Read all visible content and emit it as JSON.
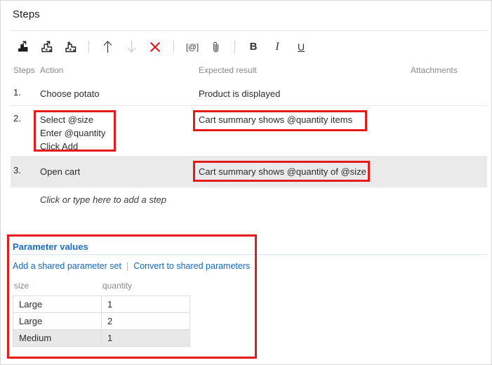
{
  "panel": {
    "title": "Steps"
  },
  "toolbar": {
    "items": [
      {
        "name": "insert-step-icon",
        "glyph": "step",
        "variant": "arrow"
      },
      {
        "name": "insert-step-above-icon",
        "glyph": "step",
        "variant": "arrow2"
      },
      {
        "name": "add-step-icon",
        "glyph": "step",
        "variant": "plus"
      },
      {
        "name": "move-up-icon",
        "glyph": "↑"
      },
      {
        "name": "move-down-icon",
        "glyph": "↓"
      },
      {
        "name": "delete-icon",
        "glyph": "✕"
      },
      {
        "name": "mention-icon",
        "glyph": "[@]"
      },
      {
        "name": "attachment-icon",
        "glyph": "paperclip"
      },
      {
        "name": "bold-icon",
        "glyph": "B"
      },
      {
        "name": "italic-icon",
        "glyph": "I"
      },
      {
        "name": "underline-icon",
        "glyph": "U"
      }
    ]
  },
  "grid": {
    "headers": {
      "steps": "Steps",
      "action": "Action",
      "expected_result": "Expected result",
      "attachments": "Attachments"
    },
    "rows": [
      {
        "number": "1.",
        "action": "Choose potato",
        "expected": "Product is displayed",
        "selected": false
      },
      {
        "number": "2.",
        "action": "Select @size\nEnter @quantity\nClick Add",
        "expected": "Cart summary shows @quantity items",
        "selected": false
      },
      {
        "number": "3.",
        "action": "Open cart",
        "expected": "Cart summary shows @quantity of @size",
        "selected": true
      }
    ],
    "add_step_hint": "Click or type here to add a step"
  },
  "parameter_values": {
    "title": "Parameter values",
    "links": {
      "add_shared": "Add a shared parameter set",
      "convert": "Convert to shared parameters"
    },
    "columns": [
      "size",
      "quantity"
    ],
    "rows": [
      {
        "size": "Large",
        "quantity": "1",
        "selected": false
      },
      {
        "size": "Large",
        "quantity": "2",
        "selected": false
      },
      {
        "size": "Medium",
        "quantity": "1",
        "selected": true
      }
    ]
  },
  "annotations": {
    "color": "#e31b1b",
    "boxes": [
      {
        "name": "highlight-step2-action"
      },
      {
        "name": "highlight-step2-expected"
      },
      {
        "name": "highlight-step3-expected"
      },
      {
        "name": "highlight-parameter-values-section"
      }
    ]
  }
}
